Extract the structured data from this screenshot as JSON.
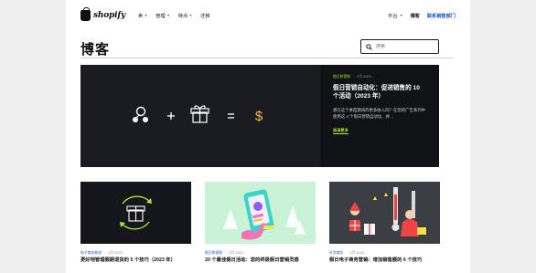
{
  "header": {
    "logo_text": "shopify",
    "menu": [
      {
        "label": "卖",
        "has_caret": true
      },
      {
        "label": "管理",
        "has_caret": true
      },
      {
        "label": "特点",
        "has_caret": true
      },
      {
        "label": "迁移",
        "has_caret": false
      }
    ],
    "platform_label": "平台",
    "blog_label": "博客",
    "cta_label": "联系销售部门"
  },
  "page_title": "博客",
  "search": {
    "placeholder": "搜索"
  },
  "hero": {
    "category": "假日和营销",
    "date": "2月 2023…",
    "title": "假日营销自动化：促进销售的 10 个活动（2023 年）",
    "description": "想在这个季度期间的更多收入吗？在您的广告系列中使用这 4 个假日营销自动化，并…",
    "read_more": "阅读更多"
  },
  "cards": [
    {
      "category": "电子商务物流",
      "date": "1月 2023…",
      "title": "更好地管理假期退货的 5 个技巧（2023 年）"
    },
    {
      "category": "假日和营销",
      "date": "2月 2023…",
      "title": "20 个最佳假日活动：您的终极假日营销灵感"
    },
    {
      "category": "社交商务",
      "date": "2月 2023…",
      "title": "假日电子商务营销：增加销售额的 6 个技巧"
    }
  ],
  "colors": {
    "accent_green": "#a3e635",
    "link_blue": "#1a55d0",
    "hero_bg": "#1b1c22",
    "card2_bg": "#c9f2d6",
    "hero_gift": "#f2b84b"
  }
}
